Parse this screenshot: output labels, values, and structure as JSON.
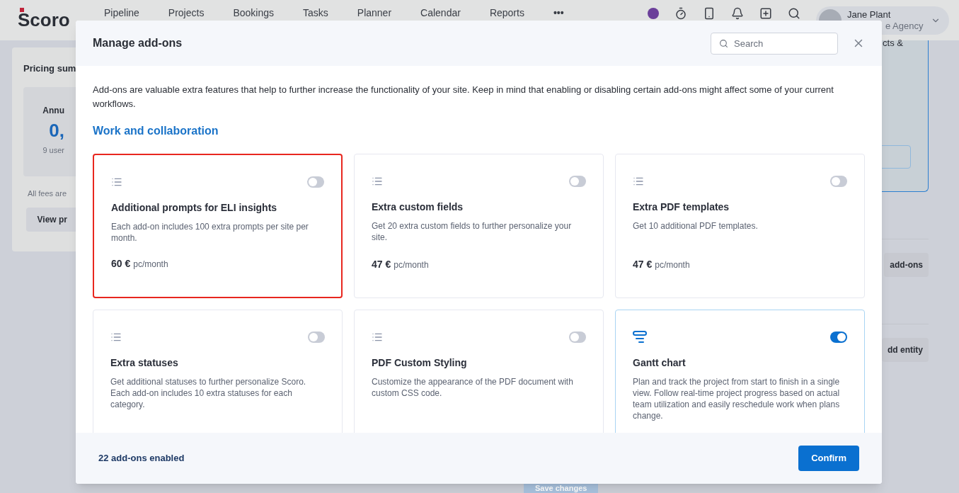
{
  "header": {
    "logo": "Scoro",
    "nav": [
      "Pipeline",
      "Projects",
      "Bookings",
      "Tasks",
      "Planner",
      "Calendar",
      "Reports"
    ],
    "more": "•••",
    "user": {
      "name": "Jane Plant",
      "company": "e Agency"
    }
  },
  "background": {
    "pricing_card": {
      "title": "Pricing sum",
      "annual_label": "Annu",
      "annual_value": "0,",
      "users": "9 user",
      "note": "All fees are",
      "button": "View pr"
    },
    "right_panel": {
      "text": "cts &",
      "buttons": [
        "add-ons",
        "dd entity"
      ]
    },
    "save_button": "Save changes"
  },
  "modal": {
    "title": "Manage add-ons",
    "search": {
      "placeholder": "Search"
    },
    "intro": "Add-ons are valuable extra features that help to further increase the functionality of your site. Keep in mind that enabling or disabling certain add-ons might affect some of your current workflows.",
    "section": "Work and collaboration",
    "addons": [
      {
        "kind": "list",
        "title": "Additional prompts for ELI insights",
        "description": "Each add-on includes 100 extra prompts per site per month.",
        "price": "60 €",
        "period": "pc/month",
        "on": false,
        "highlighted": true
      },
      {
        "kind": "list",
        "title": "Extra custom fields",
        "description": "Get 20 extra custom fields to further personalize your site.",
        "price": "47 €",
        "period": "pc/month",
        "on": false,
        "highlighted": false
      },
      {
        "kind": "list",
        "title": "Extra PDF templates",
        "description": "Get 10 additional PDF templates.",
        "price": "47 €",
        "period": "pc/month",
        "on": false,
        "highlighted": false
      },
      {
        "kind": "list",
        "title": "Extra statuses",
        "description": "Get additional statuses to further personalize Scoro. Each add-on includes 10 extra statuses for each category.",
        "on": false,
        "highlighted": false
      },
      {
        "kind": "list",
        "title": "PDF Custom Styling",
        "description": "Customize the appearance of the PDF document with custom CSS code.",
        "on": false,
        "highlighted": false
      },
      {
        "kind": "gantt",
        "title": "Gantt chart",
        "description": "Plan and track the project from start to finish in a single view. Follow real-time project progress based on actual team utilization and easily reschedule work when plans change.",
        "on": true,
        "highlighted": false
      }
    ],
    "enabled_count": "22 add-ons enabled",
    "confirm": "Confirm"
  }
}
